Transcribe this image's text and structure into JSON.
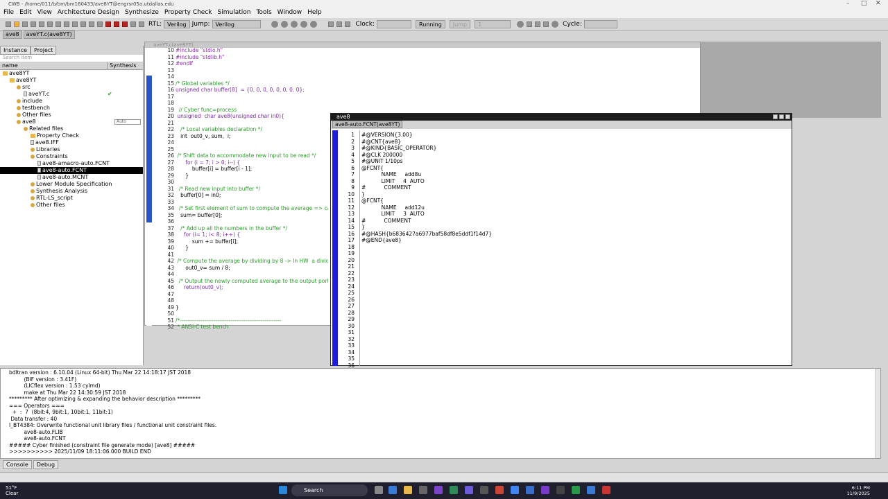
{
  "window": {
    "title": "CWB - /home/011/b/bm/bm160433/ave8YT@engrsr05a.utdallas.edu"
  },
  "menu": [
    "File",
    "Edit",
    "View",
    "Architecture Design",
    "Synthesize",
    "Property Check",
    "Simulation",
    "Tools",
    "Window",
    "Help"
  ],
  "toolbar": {
    "rtl_label": "RTL:",
    "rtl_value": "Verilog",
    "jump_label": "Jump:",
    "jump_value": "Verilog",
    "clock_label": "Clock:",
    "running": "Running",
    "jump2": "Jump",
    "cycle_label": "Cycle:",
    "one": "1"
  },
  "doc_tabs": [
    "ave8",
    "aveYT.c(ave8YT)"
  ],
  "left": {
    "tabs": [
      "Instance",
      "Project"
    ],
    "search_placeholder": "Search item",
    "col_name": "name",
    "col_synth": "Synthesis",
    "tree": [
      {
        "label": "ave8YT",
        "indent": 0,
        "icon": "folder"
      },
      {
        "label": "ave8YT",
        "indent": 1,
        "icon": "project"
      },
      {
        "label": "src",
        "indent": 2,
        "icon": "node"
      },
      {
        "label": "aveYT.c",
        "indent": 3,
        "icon": "file",
        "check": "✔"
      },
      {
        "label": "include",
        "indent": 2,
        "icon": "node"
      },
      {
        "label": "testbench",
        "indent": 2,
        "icon": "node"
      },
      {
        "label": "Other files",
        "indent": 2,
        "icon": "node"
      },
      {
        "label": "ave8",
        "indent": 2,
        "icon": "node",
        "badge": "Auto"
      },
      {
        "label": "Related files",
        "indent": 3,
        "icon": "node"
      },
      {
        "label": "Property Check",
        "indent": 4,
        "icon": "folder"
      },
      {
        "label": "ave8.IFF",
        "indent": 4,
        "icon": "file"
      },
      {
        "label": "Libraries",
        "indent": 4,
        "icon": "node"
      },
      {
        "label": "Constraints",
        "indent": 4,
        "icon": "node"
      },
      {
        "label": "ave8-amacro-auto.FCNT",
        "indent": 5,
        "icon": "file"
      },
      {
        "label": "ave8-auto.FCNT",
        "indent": 5,
        "icon": "file",
        "selected": true
      },
      {
        "label": "ave8-auto.MCNT",
        "indent": 5,
        "icon": "file"
      },
      {
        "label": "Lower Module Specification",
        "indent": 4,
        "icon": "node"
      },
      {
        "label": "Synthesis Analysis",
        "indent": 4,
        "icon": "node"
      },
      {
        "label": "RTL-LS_script",
        "indent": 4,
        "icon": "node"
      },
      {
        "label": "Other files",
        "indent": 4,
        "icon": "node"
      }
    ]
  },
  "editor": {
    "title": "aveYT.c(ave8YT)",
    "lines": [
      {
        "n": "10",
        "t": "#include \"stdio.h\"",
        "c": "pp"
      },
      {
        "n": "11",
        "t": "#include \"stdlib.h\"",
        "c": "pp"
      },
      {
        "n": "12",
        "t": "#endif",
        "c": "pp"
      },
      {
        "n": "13",
        "t": "",
        "c": ""
      },
      {
        "n": "14",
        "t": "",
        "c": ""
      },
      {
        "n": "15",
        "t": "/* Global variables */",
        "c": "cm"
      },
      {
        "n": "16",
        "t": "unsigned char buffer[8]  = {0, 0, 0, 0, 0, 0, 0, 0};",
        "c": "kw"
      },
      {
        "n": "17",
        "t": "",
        "c": ""
      },
      {
        "n": "18",
        "t": "",
        "c": ""
      },
      {
        "n": "19",
        "t": "  // Cyber func=process",
        "c": "cm"
      },
      {
        "n": "20",
        "t": " unsigned  char ave8(unsigned char in0){",
        "c": "kw"
      },
      {
        "n": "21",
        "t": "",
        "c": ""
      },
      {
        "n": "22",
        "t": "   /* Local variables declaration */",
        "c": "cm"
      },
      {
        "n": "23",
        "t": "   int  out0_v, sum,  i;",
        "c": ""
      },
      {
        "n": "24",
        "t": "",
        "c": ""
      },
      {
        "n": "25",
        "t": "",
        "c": ""
      },
      {
        "n": "26",
        "t": " /* Shift data to accommodate new input to be read */",
        "c": "cm"
      },
      {
        "n": "27",
        "t": "      for (i = 7; i > 0; i--) {",
        "c": "kw"
      },
      {
        "n": "28",
        "t": "          buffer[i] = buffer[i - 1];",
        "c": ""
      },
      {
        "n": "29",
        "t": "      }",
        "c": ""
      },
      {
        "n": "30",
        "t": "",
        "c": ""
      },
      {
        "n": "31",
        "t": "  /* Read new input into buffer */",
        "c": "cm"
      },
      {
        "n": "32",
        "t": "   buffer[0] = in0;",
        "c": ""
      },
      {
        "n": "33",
        "t": "",
        "c": ""
      },
      {
        "n": "34",
        "t": "  /* Set first element of sum to compute the average => can",
        "c": "cm"
      },
      {
        "n": "35",
        "t": "   sum= buffer[0];",
        "c": ""
      },
      {
        "n": "36",
        "t": "",
        "c": ""
      },
      {
        "n": "37",
        "t": "   /* Add up all the numbers in the buffer */",
        "c": "cm"
      },
      {
        "n": "38",
        "t": "     for (i= 1; i< 8; i++) {",
        "c": "kw"
      },
      {
        "n": "39",
        "t": "          sum += buffer[i];",
        "c": ""
      },
      {
        "n": "40",
        "t": "      }",
        "c": ""
      },
      {
        "n": "41",
        "t": "",
        "c": ""
      },
      {
        "n": "42",
        "t": " /* Compute the average by dividing by 8 -> In HW  a divide",
        "c": "cm"
      },
      {
        "n": "43",
        "t": "      out0_v= sum / 8;",
        "c": ""
      },
      {
        "n": "44",
        "t": "",
        "c": ""
      },
      {
        "n": "45",
        "t": "  /* Output the newly computed average to the output port */",
        "c": "cm"
      },
      {
        "n": "46",
        "t": "     return(out0_v);",
        "c": "kw"
      },
      {
        "n": "47",
        "t": "",
        "c": ""
      },
      {
        "n": "48",
        "t": "",
        "c": ""
      },
      {
        "n": "49",
        "t": "}",
        "c": ""
      },
      {
        "n": "50",
        "t": "",
        "c": ""
      },
      {
        "n": "51",
        "t": "/*------------------------------------------------------",
        "c": "cm"
      },
      {
        "n": "52",
        "t": " * ANSI-C test bench",
        "c": "cm"
      }
    ]
  },
  "fcnt": {
    "title": "ave8",
    "tab": "ave8-auto.FCNT(ave8YT)",
    "lines": [
      "#@VERSION{3.00}",
      "#@CNT{ave8}",
      "#@KIND{BASIC_OPERATOR}",
      "#@CLK 200000",
      "#@UNIT 1/10ps",
      "@FCNT{",
      "            NAME     add8u",
      "            LIMIT     4  AUTO",
      "#           COMMENT",
      "}",
      "@FCNT{",
      "            NAME     add12u",
      "            LIMIT     3  AUTO",
      "#           COMMENT",
      "}",
      "#@HASH{b6836427a6977baf58df8e5ddf1f14d7}",
      "#@END{ave8}",
      "",
      "",
      "",
      "",
      "",
      "",
      "",
      "",
      "",
      "",
      "",
      "",
      "",
      "",
      "",
      "",
      "",
      "",
      ""
    ]
  },
  "console": {
    "lines": [
      "bdltran version : 6.10.04 (Linux 64-bit) Thu Mar 22 14:18:17 JST 2018",
      "         (BIF version : 3.41F)",
      "         (LICflex version : 1.53 cylmd)",
      "         make at Thu Mar 22 14:30:59 JST 2018",
      "********* After optimizing & expanding the behavior description *********",
      "=== Operators ===",
      "  +  :  7  (8bit:4, 9bit:1, 10bit:1, 11bit:1)",
      " Data transfer : 40",
      "I_BT4384: Overwrite functional unit library files / functional unit constraint files.",
      "         ave8-auto.FLIB",
      "         ave8-auto.FCNT",
      "##### Cyber finished (constraint file generate mode) [ave8] #####",
      ">>>>>>>>>> 2025/11/09 18:11:06.000 BUILD END"
    ],
    "tabs": [
      "Console",
      "Debug"
    ]
  },
  "taskbar": {
    "temp": "51°F",
    "weather": "Clear",
    "search": "Search",
    "time": "6:11 PM",
    "date": "11/9/2025"
  }
}
